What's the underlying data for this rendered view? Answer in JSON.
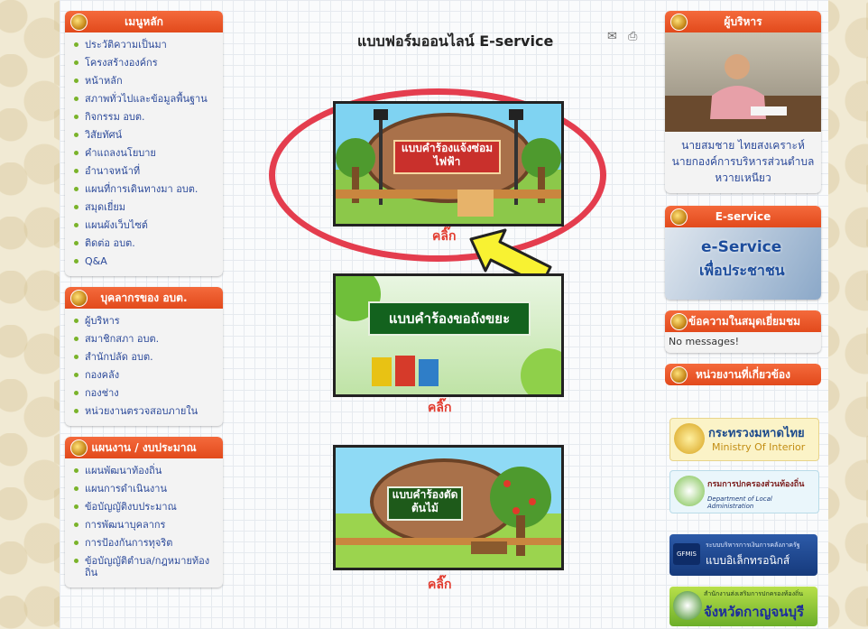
{
  "menu_main": {
    "header": "เมนูหลัก",
    "items": [
      "ประวัติความเป็นมา",
      "โครงสร้างองค์กร",
      "หน้าหลัก",
      "สภาพทั่วไปและข้อมูลพื้นฐาน",
      "กิจกรรม อบต.",
      "วิสัยทัศน์",
      "คำแถลงนโยบาย",
      "อำนาจหน้าที่",
      "แผนที่การเดินทางมา อบต.",
      "สมุดเยี่ยม",
      "แผนผังเว็บไซต์",
      "ติดต่อ อบต.",
      "Q&A"
    ]
  },
  "menu_staff": {
    "header": "บุคลากรของ อบต.",
    "items": [
      "ผู้บริหาร",
      "สมาชิกสภา อบต.",
      "สำนักปลัด อบต.",
      "กองคลัง",
      "กองช่าง",
      "หน่วยงานตรวจสอบภายใน"
    ]
  },
  "menu_plan": {
    "header": "แผนงาน / งบประมาณ",
    "items": [
      "แผนพัฒนาท้องถิ่น",
      "แผนการดำเนินงาน",
      "ข้อบัญญัติงบประมาณ",
      "การพัฒนาบุคลากร",
      "การป้องกันการทุจริต",
      "ข้อบัญญัติตำบล/กฎหมายท้องถิ่น"
    ]
  },
  "main": {
    "title": "แบบฟอร์มออนไลน์ E-service",
    "forms": [
      {
        "label": "แบบคำร้องแจ้งซ่อมไฟฟ้า",
        "link": "คลิ๊ก"
      },
      {
        "label": "แบบคำร้องขอถังขยะ",
        "link": "คลิ๊ก"
      },
      {
        "label": "แบบคำร้องตัดต้นไม้",
        "link": "คลิ๊ก"
      }
    ]
  },
  "executive": {
    "header": "ผู้บริหาร",
    "name": "นายสมชาย ไทยสงเคราะห์",
    "position": "นายกองค์การบริหารส่วนตำบลหวายเหนียว"
  },
  "eservice": {
    "header": "E-service",
    "banner_line1": "e-Service",
    "banner_line2": "เพื่อประชาชน"
  },
  "guestbook": {
    "header": "ข้อความในสมุดเยี่ยมชม",
    "text": "No messages!"
  },
  "agencies": {
    "header": "หน่วยงานที่เกี่ยวข้อง",
    "logos": [
      {
        "line1": "กระทรวงมหาดไทย",
        "line2": "Ministry Of Interior"
      },
      {
        "line1": "กรมการปกครองส่วนท้องถิ่น",
        "line2": "Department of Local Administration"
      },
      {
        "line1": "ระบบบริหารการเงินการคลังภาครัฐ",
        "line2": "แบบอิเล็กทรอนิกส์",
        "badge": "GFMIS"
      },
      {
        "line1": "สำนักงานส่งเสริมการปกครองท้องถิ่น",
        "line2": "จังหวัดกาญจนบุรี"
      }
    ]
  }
}
